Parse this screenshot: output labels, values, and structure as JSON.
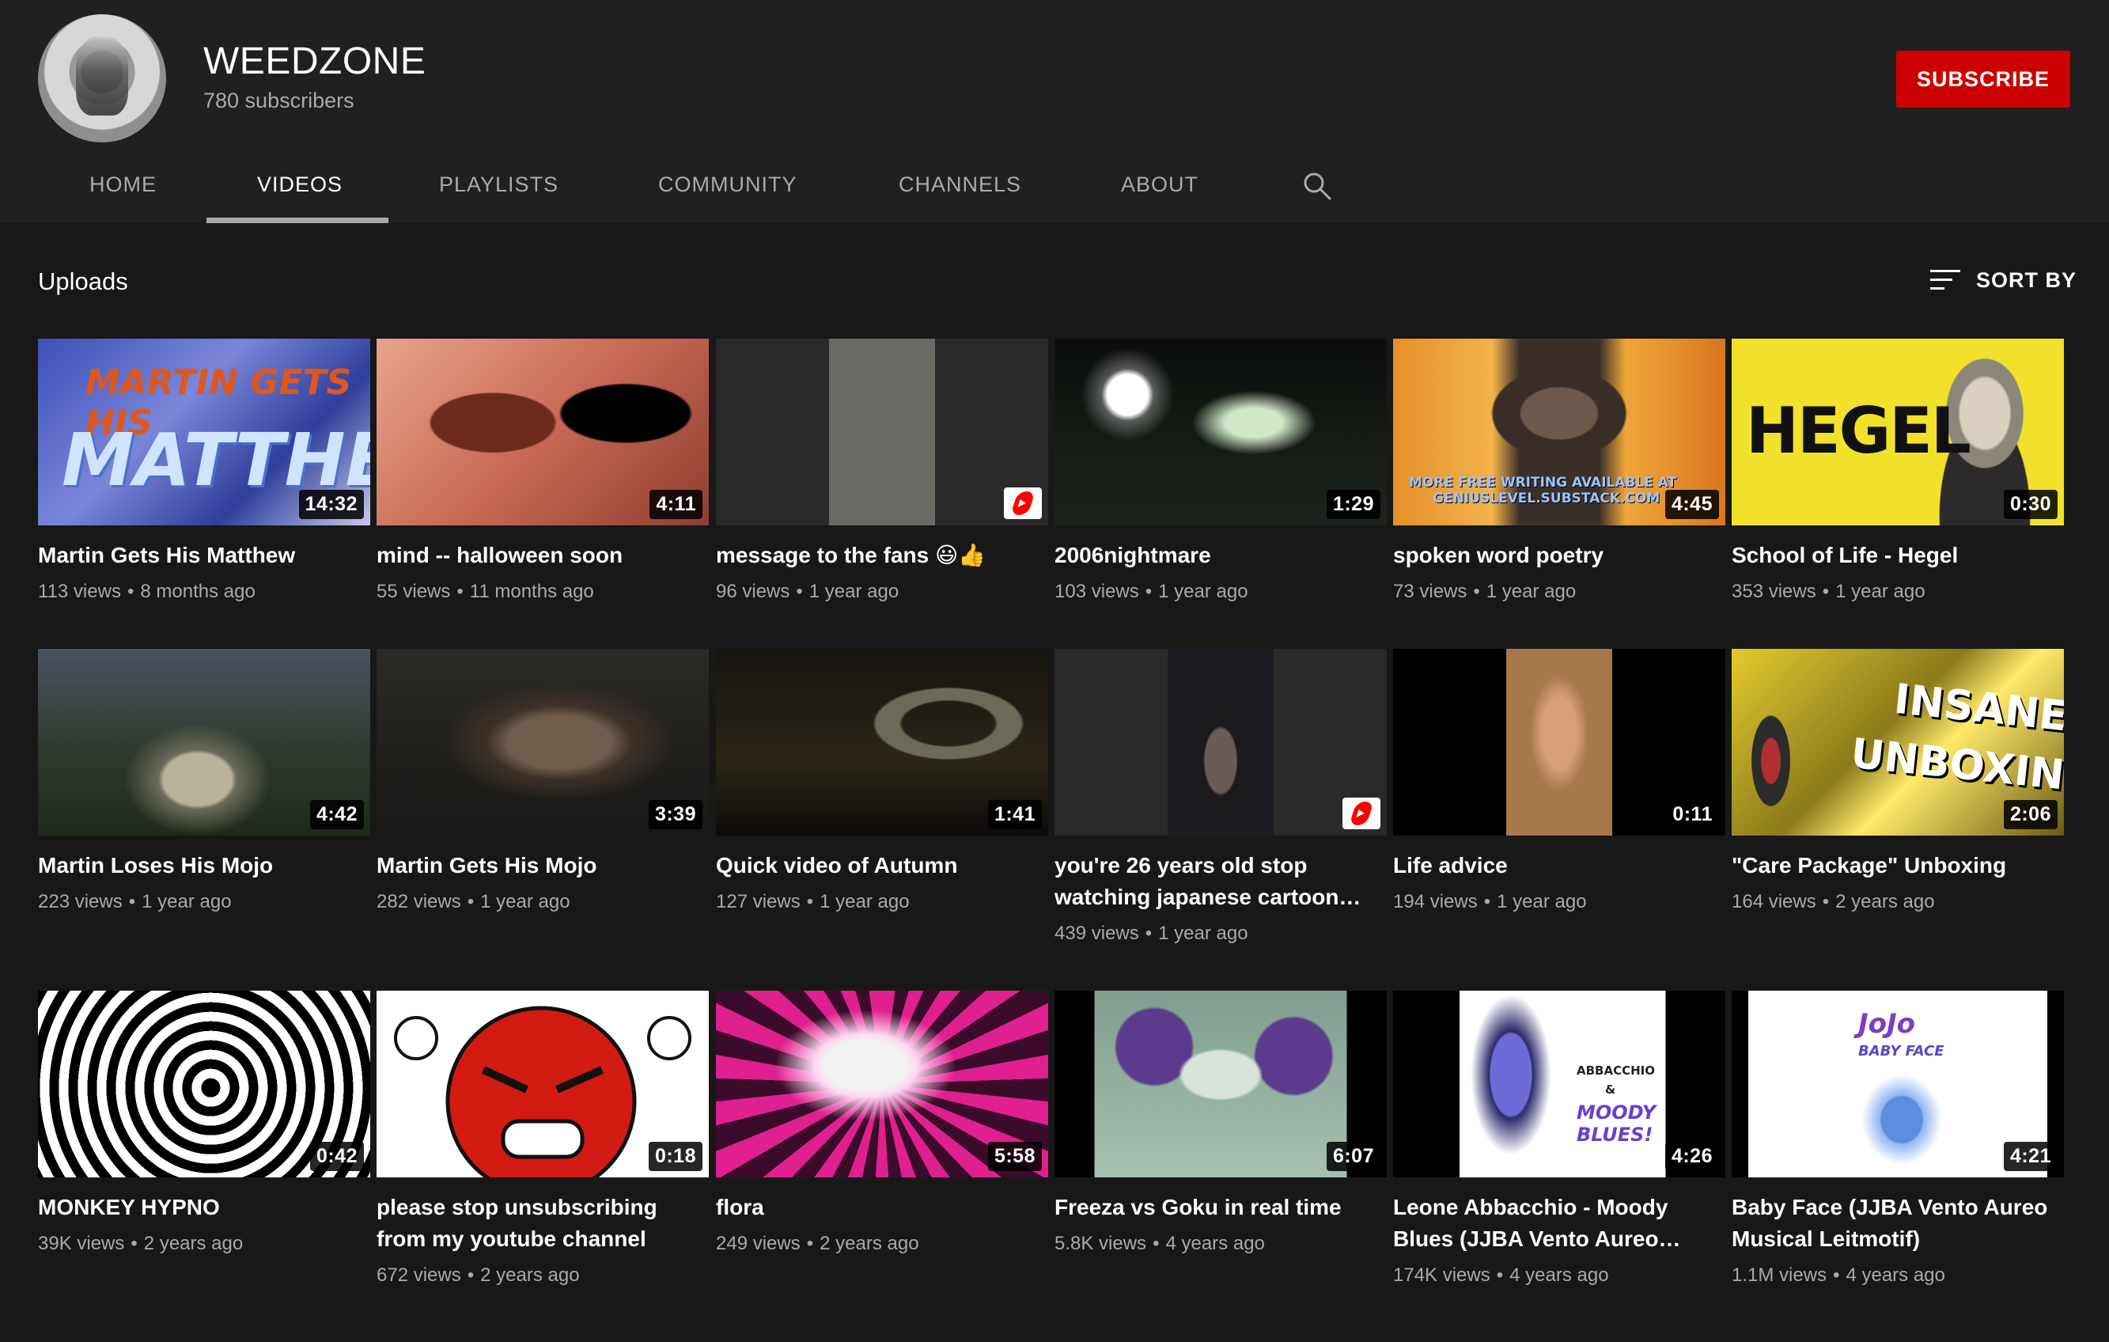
{
  "channel": {
    "name": "WEEDZONE",
    "subscribers": "780 subscribers",
    "subscribe_label": "SUBSCRIBE",
    "accent": "#cc0000"
  },
  "tabs": [
    {
      "label": "HOME",
      "active": false
    },
    {
      "label": "VIDEOS",
      "active": true
    },
    {
      "label": "PLAYLISTS",
      "active": false
    },
    {
      "label": "COMMUNITY",
      "active": false
    },
    {
      "label": "CHANNELS",
      "active": false
    },
    {
      "label": "ABOUT",
      "active": false
    }
  ],
  "search_icon": "search-icon",
  "section": {
    "title": "Uploads",
    "sort_label": "SORT BY",
    "sort_icon": "sort-icon"
  },
  "thumb_text": {
    "martin_top": "MARTIN GETS HIS",
    "martin_bottom": "MATTHEW",
    "poetry_caption_1": "MORE FREE WRITING AVAILABLE AT",
    "poetry_caption_2": "GENIUSLEVEL.SUBSTACK.COM",
    "hegel": "HEGEL",
    "insane": "INSANE",
    "unboxing": "UNBOXING!",
    "abbacchio_1": "ABBACCHIO",
    "abbacchio_2": "&",
    "abbacchio_3": "MOODY",
    "abbacchio_4": "BLUES!",
    "babyface_title": "JoJo",
    "babyface_sub": "BABY FACE"
  },
  "videos": [
    {
      "title": "Martin Gets His Matthew",
      "views": "113 views",
      "age": "8 months ago",
      "duration": "14:32"
    },
    {
      "title": "mind -- halloween soon",
      "views": "55 views",
      "age": "11 months ago",
      "duration": "4:11"
    },
    {
      "title": "message to the fans 😃👍",
      "views": "96 views",
      "age": "1 year ago",
      "duration": "",
      "shorts": true
    },
    {
      "title": "2006nightmare",
      "views": "103 views",
      "age": "1 year ago",
      "duration": "1:29"
    },
    {
      "title": "spoken word poetry",
      "views": "73 views",
      "age": "1 year ago",
      "duration": "4:45"
    },
    {
      "title": "School of Life - Hegel",
      "views": "353 views",
      "age": "1 year ago",
      "duration": "0:30"
    },
    {
      "title": "Martin Loses His Mojo",
      "views": "223 views",
      "age": "1 year ago",
      "duration": "4:42"
    },
    {
      "title": "Martin Gets His Mojo",
      "views": "282 views",
      "age": "1 year ago",
      "duration": "3:39"
    },
    {
      "title": "Quick video of Autumn",
      "views": "127 views",
      "age": "1 year ago",
      "duration": "1:41"
    },
    {
      "title": "you're 26 years old stop watching japanese cartoon…",
      "views": "439 views",
      "age": "1 year ago",
      "duration": "",
      "shorts": true
    },
    {
      "title": "Life advice",
      "views": "194 views",
      "age": "1 year ago",
      "duration": "0:11"
    },
    {
      "title": "\"Care Package\" Unboxing",
      "views": "164 views",
      "age": "2 years ago",
      "duration": "2:06"
    },
    {
      "title": "MONKEY HYPNO",
      "views": "39K views",
      "age": "2 years ago",
      "duration": "0:42"
    },
    {
      "title": "please stop unsubscribing from my youtube channel",
      "views": "672 views",
      "age": "2 years ago",
      "duration": "0:18"
    },
    {
      "title": "flora",
      "views": "249 views",
      "age": "2 years ago",
      "duration": "5:58"
    },
    {
      "title": "Freeza vs Goku in real time",
      "views": "5.8K views",
      "age": "4 years ago",
      "duration": "6:07"
    },
    {
      "title": "Leone Abbacchio - Moody Blues (JJBA Vento Aureo…",
      "views": "174K views",
      "age": "4 years ago",
      "duration": "4:26"
    },
    {
      "title": "Baby Face (JJBA Vento Aureo Musical Leitmotif)",
      "views": "1.1M views",
      "age": "4 years ago",
      "duration": "4:21"
    }
  ]
}
